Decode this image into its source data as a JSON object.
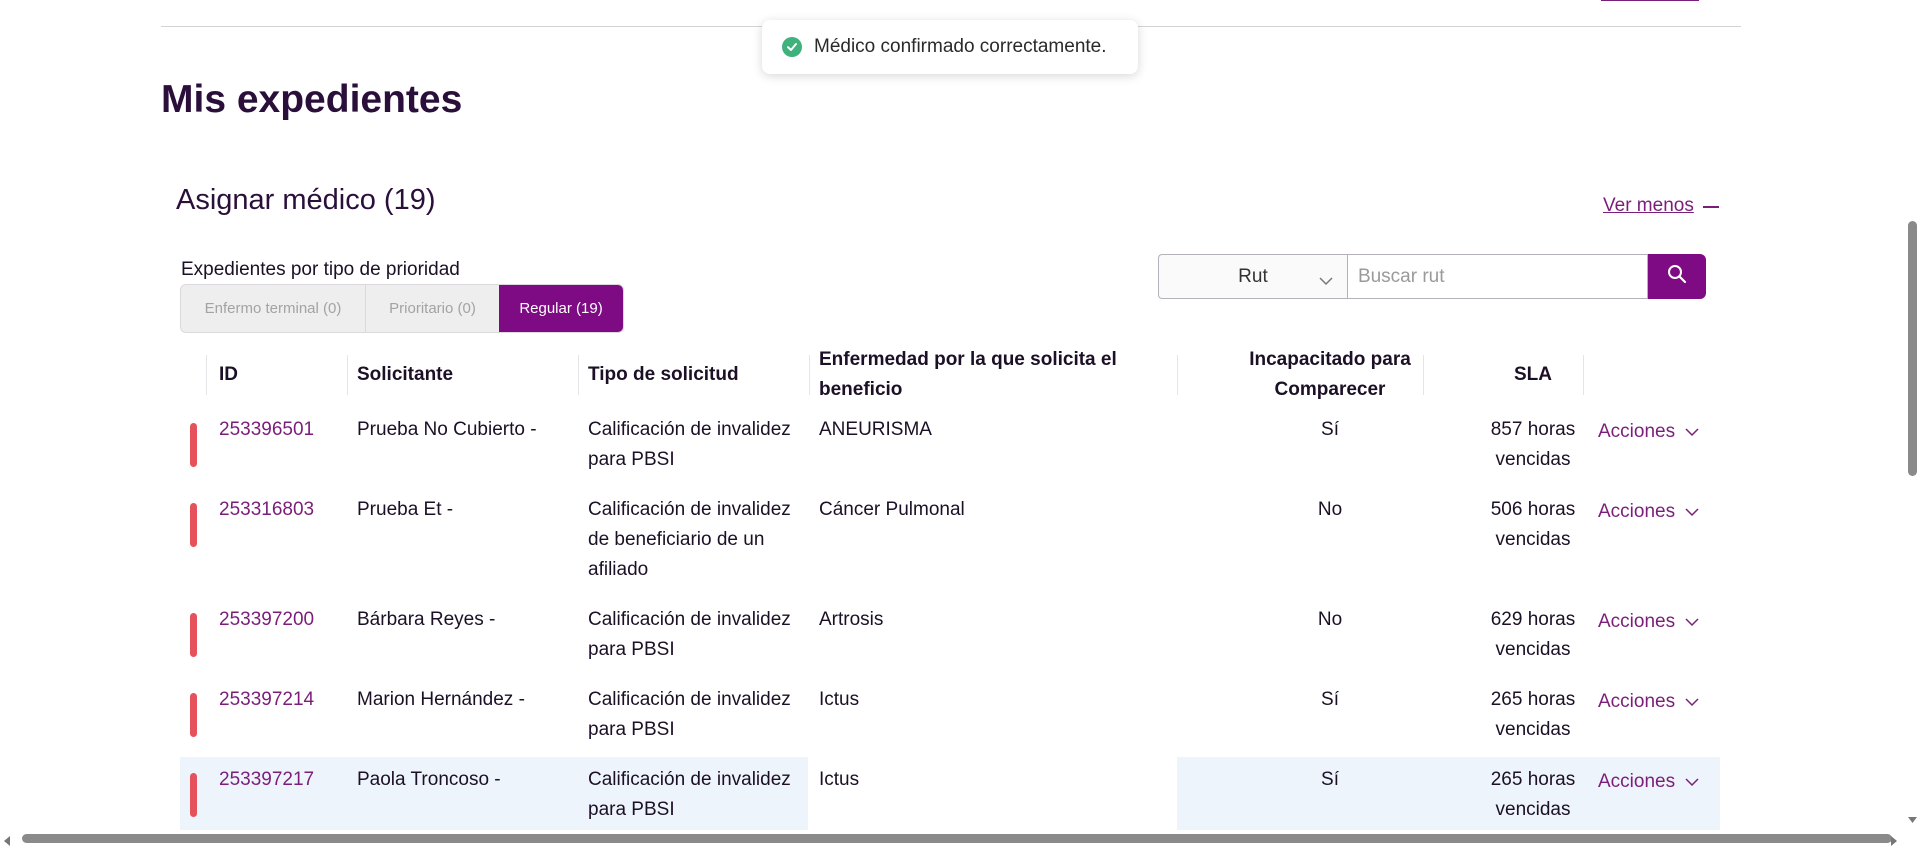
{
  "toast": {
    "message": "Médico confirmado correctamente."
  },
  "page": {
    "title": "Mis expedientes"
  },
  "section": {
    "title": "Asignar médico (19)",
    "toggle_label": "Ver menos"
  },
  "priority": {
    "label": "Expedientes por tipo de prioridad",
    "tabs": [
      {
        "label": "Enfermo terminal (0)",
        "active": false
      },
      {
        "label": "Prioritario (0)",
        "active": false
      },
      {
        "label": "Regular (19)",
        "active": true
      }
    ]
  },
  "search": {
    "select_value": "Rut",
    "placeholder": "Buscar rut"
  },
  "table": {
    "headers": {
      "id": "ID",
      "solicitante": "Solicitante",
      "tipo": "Tipo de solicitud",
      "enfermedad": "Enfermedad por la que solicita el beneficio",
      "incapacitado": "Incapacitado para Comparecer",
      "sla": "SLA"
    },
    "rows": [
      {
        "id": "253396501",
        "solicitante": "Prueba No Cubierto -",
        "tipo": "Calificación de invalidez para PBSI",
        "enfermedad": "ANEURISMA",
        "incapacitado": "Sí",
        "sla": "857 horas vencidas",
        "acciones": "Acciones"
      },
      {
        "id": "253316803",
        "solicitante": "Prueba Et -",
        "tipo": "Calificación de invalidez de beneficiario de un afiliado",
        "enfermedad": "Cáncer Pulmonal",
        "incapacitado": "No",
        "sla": "506 horas vencidas",
        "acciones": "Acciones"
      },
      {
        "id": "253397200",
        "solicitante": "Bárbara Reyes -",
        "tipo": "Calificación de invalidez para PBSI",
        "enfermedad": "Artrosis",
        "incapacitado": "No",
        "sla": "629 horas vencidas",
        "acciones": "Acciones"
      },
      {
        "id": "253397214",
        "solicitante": "Marion Hernández -",
        "tipo": "Calificación de invalidez para PBSI",
        "enfermedad": "Ictus",
        "incapacitado": "Sí",
        "sla": "265 horas vencidas",
        "acciones": "Acciones"
      },
      {
        "id": "253397217",
        "solicitante": "Paola Troncoso -",
        "tipo": "Calificación de invalidez para PBSI",
        "enfermedad": "Ictus",
        "incapacitado": "Sí",
        "sla": "265 horas vencidas",
        "acciones": "Acciones"
      }
    ]
  },
  "colors": {
    "accent": "#7e0b84",
    "link": "#7b1e7a",
    "priority_bar": "#e5525b",
    "toast_success": "#3fb17d"
  }
}
